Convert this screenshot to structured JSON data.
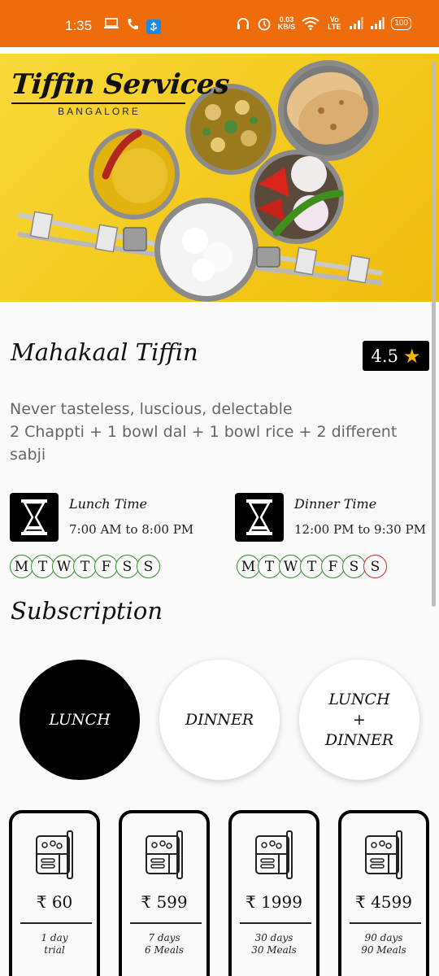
{
  "status_bar": {
    "time": "1:35",
    "net_speed_value": "0.03",
    "net_speed_unit": "KB/S",
    "volte": "Vo LTE",
    "battery": "100",
    "background_color": "#ee6c0c"
  },
  "hero": {
    "logo_title": "Tiffin Services",
    "logo_subtitle": "BANGALORE"
  },
  "restaurant": {
    "name": "Mahakaal Tiffin",
    "rating": "4.5",
    "rating_icon": "star-icon",
    "description": "Never tasteless, luscious, delectable\n2 Chappti + 1 bowl dal + 1 bowl rice + 2 different sabji"
  },
  "lunch": {
    "label": "Lunch Time",
    "time": "7:00 AM to 8:00 PM",
    "days": [
      {
        "letter": "M",
        "available": true
      },
      {
        "letter": "T",
        "available": true
      },
      {
        "letter": "W",
        "available": true
      },
      {
        "letter": "T",
        "available": true
      },
      {
        "letter": "F",
        "available": true
      },
      {
        "letter": "S",
        "available": true
      },
      {
        "letter": "S",
        "available": true
      }
    ]
  },
  "dinner": {
    "label": "Dinner Time",
    "time": "12:00 PM to 9:30 PM",
    "days": [
      {
        "letter": "M",
        "available": true
      },
      {
        "letter": "T",
        "available": true
      },
      {
        "letter": "W",
        "available": true
      },
      {
        "letter": "T",
        "available": true
      },
      {
        "letter": "F",
        "available": true
      },
      {
        "letter": "S",
        "available": true
      },
      {
        "letter": "S",
        "available": false
      }
    ]
  },
  "subscription": {
    "title": "Subscription",
    "meal_types": [
      {
        "label": "LUNCH",
        "selected": true
      },
      {
        "label": "DINNER",
        "selected": false
      },
      {
        "label": "LUNCH\n+\nDINNER",
        "selected": false
      }
    ],
    "plans": [
      {
        "price": "₹ 60",
        "duration": "1 day",
        "meals": "trial"
      },
      {
        "price": "₹ 599",
        "duration": "7 days",
        "meals": "6 Meals"
      },
      {
        "price": "₹ 1999",
        "duration": "30 days",
        "meals": "30 Meals"
      },
      {
        "price": "₹ 4599",
        "duration": "90 days",
        "meals": "90 Meals"
      }
    ]
  },
  "colors": {
    "available_day": "#2f8f2f",
    "unavailable_day": "#d32626",
    "accent_star": "#f6b400",
    "hero_background": "#f3c81a"
  }
}
